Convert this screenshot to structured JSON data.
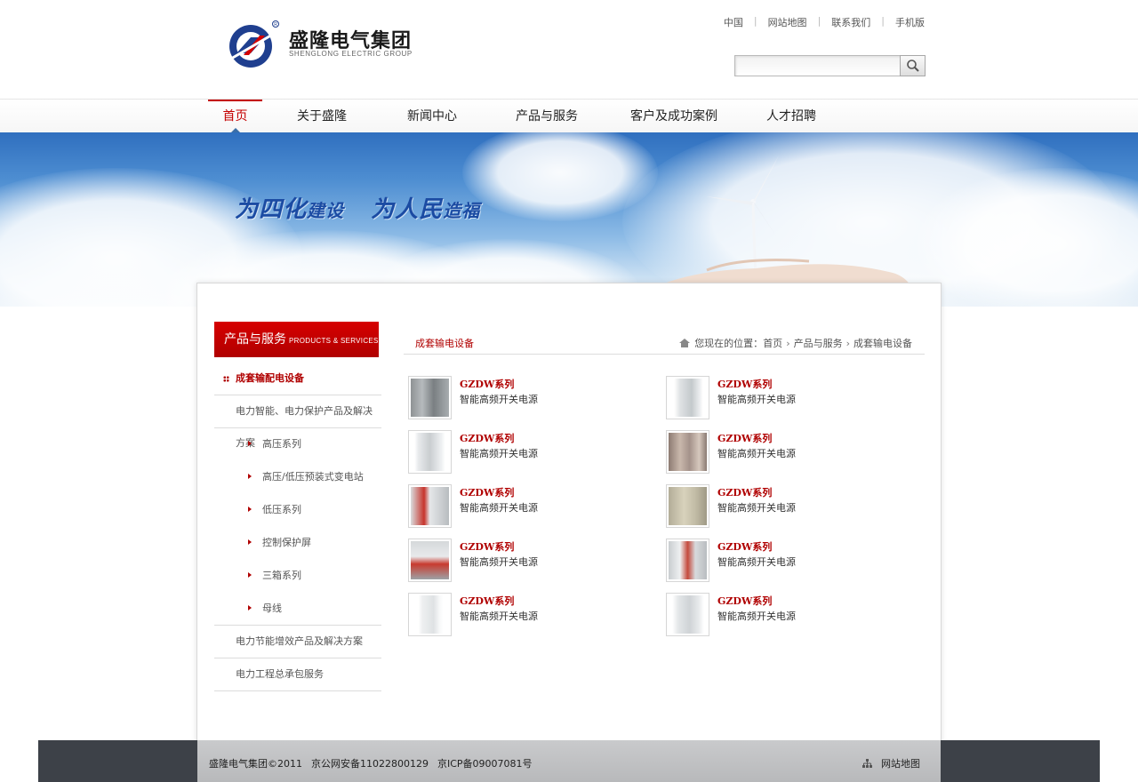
{
  "header": {
    "logo_name": "盛隆电气集团",
    "logo_sub": "SHENGLONG ELECTRIC GROUP",
    "top_links": [
      "中国",
      "网站地图",
      "联系我们",
      "手机版"
    ],
    "search": {
      "value": "",
      "placeholder": ""
    },
    "search_icon": "magnifier-icon"
  },
  "nav": {
    "items": [
      "首页",
      "关于盛隆",
      "新闻中心",
      "产品与服务",
      "客户及成功案例",
      "人才招聘"
    ],
    "active": "首页"
  },
  "banner": {
    "slogan_part1_big": "为四化",
    "slogan_part1_small": "建设",
    "slogan_part2_big": "为人民",
    "slogan_part2_small": "造福"
  },
  "sidebar": {
    "title": "产品与服务",
    "title_en": "PRODUCTS & SERVICES",
    "items": [
      {
        "label": "成套输配电设备",
        "active": true
      },
      {
        "label": "电力智能、电力保护产品及解决方案"
      },
      {
        "label": "高压系列",
        "sub": true
      },
      {
        "label": "高压/低压预装式变电站",
        "sub": true
      },
      {
        "label": "低压系列",
        "sub": true
      },
      {
        "label": "控制保护屏",
        "sub": true
      },
      {
        "label": "三箱系列",
        "sub": true
      },
      {
        "label": "母线",
        "sub": true
      },
      {
        "label": "电力节能增效产品及解决方案"
      },
      {
        "label": "电力工程总承包服务"
      }
    ]
  },
  "breadcrumb": {
    "section_title": "成套输电设备",
    "prefix": "您现在的位置：",
    "path": [
      "首页",
      "产品与服务",
      "成套输电设备"
    ]
  },
  "products": [
    {
      "name": "GZDW系列",
      "desc": "智能高频开关电源"
    },
    {
      "name": "GZDW系列",
      "desc": "智能高频开关电源"
    },
    {
      "name": "GZDW系列",
      "desc": "智能高频开关电源"
    },
    {
      "name": "GZDW系列",
      "desc": "智能高频开关电源"
    },
    {
      "name": "GZDW系列",
      "desc": "智能高频开关电源"
    },
    {
      "name": "GZDW系列",
      "desc": "智能高频开关电源"
    },
    {
      "name": "GZDW系列",
      "desc": "智能高频开关电源"
    },
    {
      "name": "GZDW系列",
      "desc": "智能高频开关电源"
    },
    {
      "name": "GZDW系列",
      "desc": "智能高频开关电源"
    },
    {
      "name": "GZDW系列",
      "desc": "智能高频开关电源"
    }
  ],
  "footer": {
    "copyright": "盛隆电气集团©2011",
    "police": "京公网安备11022800129",
    "icp": "京ICP备09007081号",
    "sitemap": "网站地图"
  },
  "colors": {
    "brand_red": "#c40000",
    "brand_blue": "#1b4ba3",
    "footer_dark": "#3d4148"
  }
}
